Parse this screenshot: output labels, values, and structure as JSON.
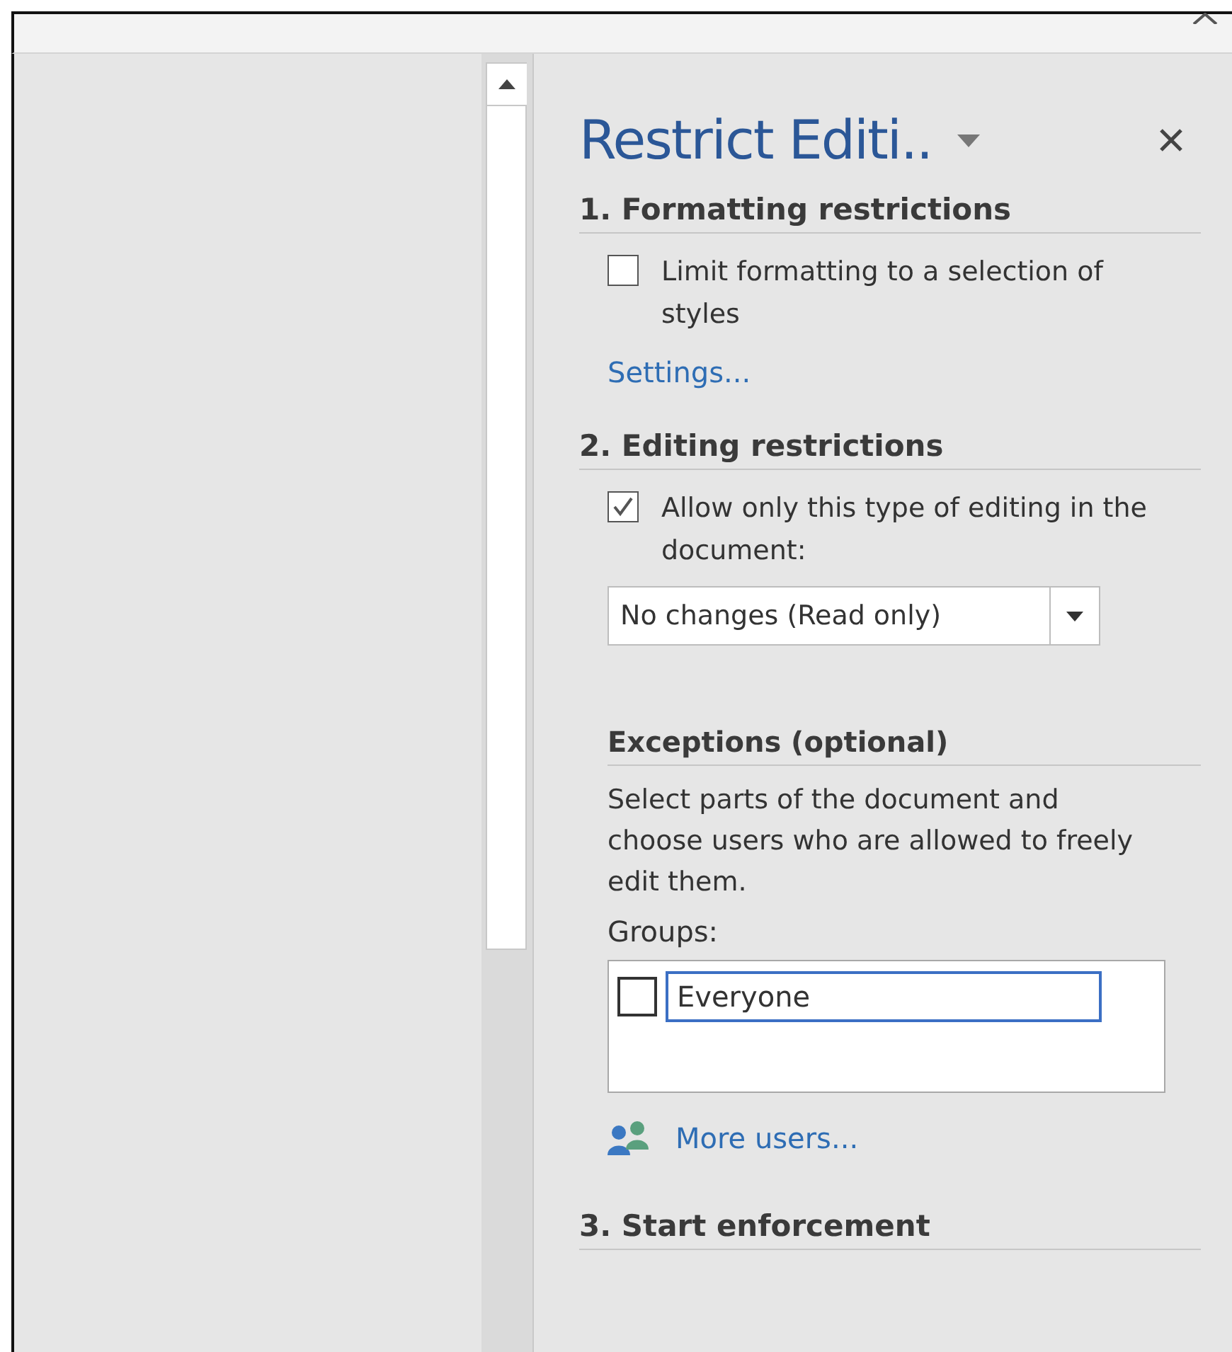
{
  "pane": {
    "title": "Restrict Editi.."
  },
  "formatting": {
    "heading": "1. Formatting restrictions",
    "option": {
      "label": "Limit formatting to a selection of styles",
      "checked": false
    },
    "link": "Settings..."
  },
  "editing": {
    "heading": "2. Editing restrictions",
    "option": {
      "label": "Allow only this type of editing in the document:",
      "checked": true
    },
    "dropdown": {
      "value": "No changes (Read only)"
    }
  },
  "exceptions": {
    "heading": "Exceptions (optional)",
    "description": "Select parts of the document and choose users who are allowed to freely edit them.",
    "groups_label": "Groups:",
    "groups": [
      {
        "name": "Everyone",
        "checked": false,
        "selected": true
      }
    ],
    "link": "More users..."
  },
  "enforcement": {
    "heading": "3. Start enforcement"
  }
}
